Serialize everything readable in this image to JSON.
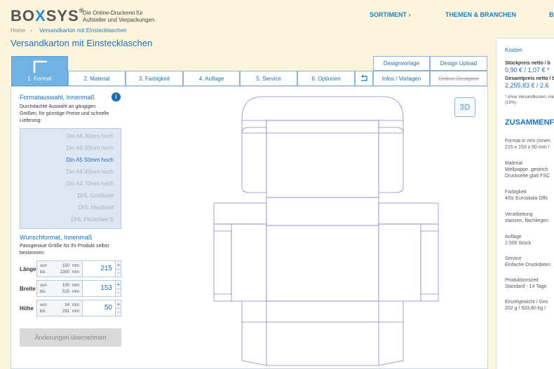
{
  "header": {
    "logo_left": "BO",
    "logo_x": "X",
    "logo_right": "SYS",
    "logo_reg": "®",
    "tagline_1": "Die Online-Druckerei für",
    "tagline_2": "Aufsteller und Verpackungen",
    "nav": [
      "SORTIMENT ›",
      "THEMEN & BRANCHEN",
      "B"
    ]
  },
  "breadcrumb": {
    "home": "Home",
    "sep": "›",
    "current": "Versandkarton mit Einstecklaschen"
  },
  "page_title": "Versandkarton mit Einstecklaschen",
  "tabs": {
    "format": "1. Format",
    "material": "2. Material",
    "farbigkeit": "3. Farbigkeit",
    "auflage": "4. Auflage",
    "service": "5. Service",
    "optionen": "6. Optionen"
  },
  "top_buttons": {
    "designvorlage": "Designvorlage",
    "design_upload": "Design Upload",
    "infos": "Infos / Vorlagen",
    "online_designer": "Online-Designer"
  },
  "format_section": {
    "title": "Formatauswahl, Innenmaß",
    "info": "i",
    "desc": [
      "Durchdachte Auswahl an gängigen",
      "Größen, für günstige Preise und schnelle",
      "Lieferung:"
    ],
    "items": [
      "Din A6 30mm hoch",
      "Din A5 30mm hoch",
      "Din A5 50mm hoch",
      "Din A4 40mm hoch",
      "Din A4 70mm hoch",
      "DHL Großbrief",
      "DHL Maxibrief",
      "DHL Päckchen S"
    ],
    "selected_index": 2
  },
  "custom_section": {
    "title": "Wunschformat, Innenmaß",
    "desc": [
      "Passgenaue Größe für Ihr Produkt selbst",
      "bestimmen:"
    ],
    "dims": [
      {
        "label": "Länge",
        "von": "150",
        "bis": "1300",
        "unit": "mm",
        "value": "215"
      },
      {
        "label": "Breite",
        "von": "100",
        "bis": "515",
        "unit": "mm",
        "value": "153"
      },
      {
        "label": "Höhe",
        "von": "14",
        "bis": "291",
        "unit": "mm",
        "value": "50"
      }
    ],
    "von_label": "von",
    "bis_label": "bis",
    "plus": "+",
    "minus": "-",
    "apply": "Änderungen übernehmen"
  },
  "preview": {
    "btn_3d": "3D"
  },
  "costs": {
    "title": "Kosten",
    "unit_price_label": "Stückpreis netto / b",
    "unit_price": "0,90 € / 1,07 € *",
    "total_label": "Gesamtpreis netto / b",
    "total": "2.255,83 € / 2.6",
    "note_1": "* ohne Versandkosten, inkl.",
    "note_2": "(19%)",
    "summary_title": "ZUSAMMENF",
    "format_label": "Format in mm (Innen",
    "format_val": "215 x 153 x 50 mm /",
    "material_label": "Material",
    "material_val": "Wellpappe, gestrich",
    "material_val2": "Druckseite glatt FSC",
    "farb_label": "Farbigkeit",
    "farb_val": "4/0c Euroskala Offs",
    "verarb_label": "Verarbeitung",
    "verarb_val": "stanzen, flachliegen",
    "auflage_label": "Auflage",
    "auflage_val": "2.500 Stück",
    "service_label": "Service",
    "service_val": "Einfache Druckdaten",
    "prod_label": "Produktionszeit",
    "prod_val": "Standard - 14 Tage",
    "gewicht_label": "Einzelgewicht / Ges",
    "gewicht_val": "202 g / 503,80 kg /"
  },
  "colors": {
    "accent": "#1a6fb5",
    "active_tab": "#6fb3e4",
    "background": "#fdf4dc"
  }
}
